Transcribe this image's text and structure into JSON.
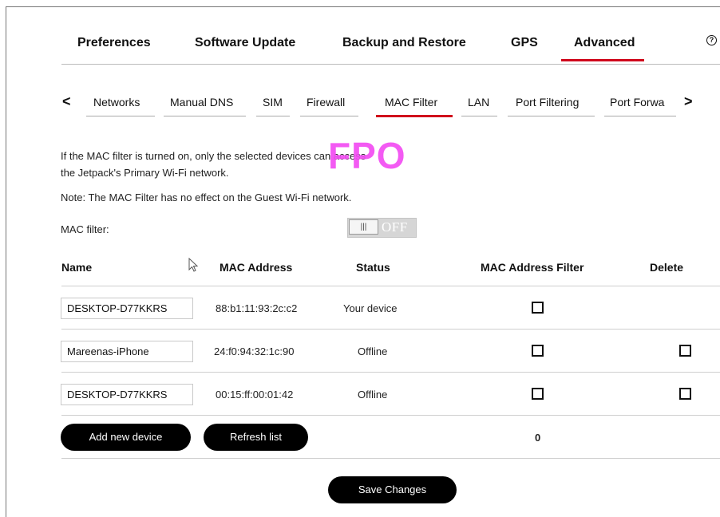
{
  "help_label": "?",
  "top_tabs": [
    {
      "label": "Preferences",
      "active": false
    },
    {
      "label": "Software Update",
      "active": false
    },
    {
      "label": "Backup and Restore",
      "active": false
    },
    {
      "label": "GPS",
      "active": false
    },
    {
      "label": "Advanced",
      "active": true
    }
  ],
  "sub_nav": {
    "prev": "<",
    "next": ">",
    "tabs": [
      {
        "label": "Networks",
        "active": false
      },
      {
        "label": "Manual DNS",
        "active": false
      },
      {
        "label": "SIM",
        "active": false
      },
      {
        "label": "Firewall",
        "active": false
      },
      {
        "label": "MAC Filter",
        "active": true
      },
      {
        "label": "LAN",
        "active": false
      },
      {
        "label": "Port Filtering",
        "active": false
      },
      {
        "label": "Port Forwa",
        "active": false
      }
    ]
  },
  "description": {
    "line1": "If the MAC filter is turned on, only the selected devices can access",
    "line2": "the Jetpack's Primary Wi-Fi network.",
    "note": "Note: The MAC Filter has no effect on the Guest Wi-Fi network."
  },
  "fpo_watermark": "FPO",
  "mac_filter": {
    "label": "MAC filter:",
    "toggle_knob": "|||",
    "toggle_state": "OFF"
  },
  "table": {
    "headers": {
      "name": "Name",
      "mac": "MAC Address",
      "status": "Status",
      "filter": "MAC Address Filter",
      "delete": "Delete"
    },
    "rows": [
      {
        "name": "DESKTOP-D77KKRS",
        "mac": "88:b1:11:93:2c:c2",
        "status": "Your device",
        "filter_checked": false,
        "deletable": false
      },
      {
        "name": "Mareenas-iPhone",
        "mac": "24:f0:94:32:1c:90",
        "status": "Offline",
        "filter_checked": false,
        "deletable": true
      },
      {
        "name": "DESKTOP-D77KKRS",
        "mac": "00:15:ff:00:01:42",
        "status": "Offline",
        "filter_checked": false,
        "deletable": true
      }
    ],
    "selected_count": "0"
  },
  "buttons": {
    "add_device": "Add new device",
    "refresh": "Refresh list",
    "save": "Save Changes"
  },
  "colors": {
    "accent": "#d0021b",
    "fpo": "#f24df2",
    "button": "#000000"
  }
}
